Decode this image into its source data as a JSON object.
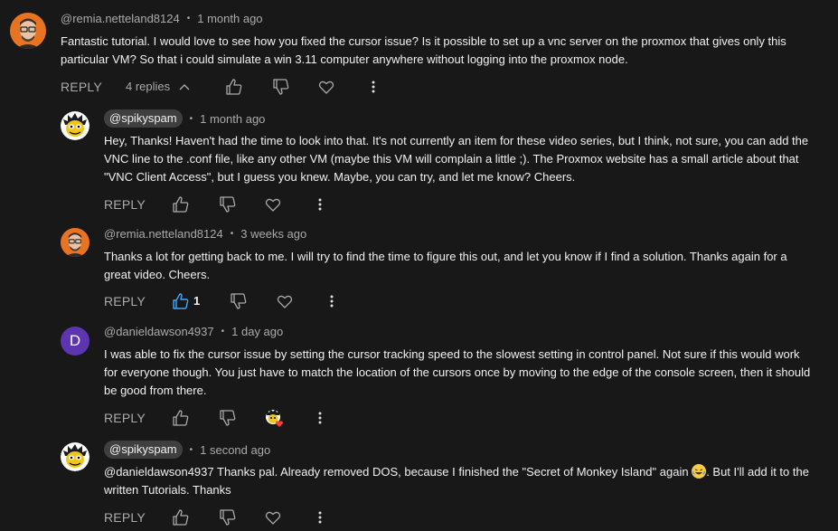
{
  "comments": [
    {
      "author": "@remia.netteland8124",
      "time": "1 month ago",
      "text_lines": [
        "Fantastic tutorial. I would love to see how you fixed the cursor issue? Is it possible to set up a vnc server on the proxmox that gives only this",
        "particular VM? So that i could simulate a win 3.11 computer anywhere without logging into the proxmox node."
      ],
      "reply_label": "REPLY",
      "replies_label": "4 replies"
    }
  ],
  "replies": [
    {
      "author": "@spikyspam",
      "time": "1 month ago",
      "text_lines": [
        "Hey, Thanks! Haven't had the time to look into that. It's not currently an item for these video series, but I think, not sure, you can add the",
        "VNC line to the .conf file, like any other VM (maybe this VM will complain a little ;). The Proxmox website has a small article about that",
        "\"VNC Client Access\", but I guess you knew. Maybe, you can try, and let me know? Cheers."
      ],
      "reply_label": "REPLY"
    },
    {
      "author": "@remia.netteland8124",
      "time": "3 weeks ago",
      "text_lines": [
        "Thanks a lot for getting back to me. I will try to find the time to figure this out, and let you know if I find a solution. Thanks again for a",
        "great video. Cheers."
      ],
      "reply_label": "REPLY",
      "like_count": "1"
    },
    {
      "author": "@danieldawson4937",
      "avatar_letter": "D",
      "time": "1 day ago",
      "text_lines": [
        "I was able to fix the cursor issue by setting the cursor tracking speed to the slowest setting in control panel. Not sure if this would work",
        "for everyone though. You just have to match the location of the cursors once by moving to the edge of the console screen, then it should",
        "be good from there."
      ],
      "reply_label": "REPLY"
    },
    {
      "author": "@spikyspam",
      "time": "1 second ago",
      "mention": "@danieldawson4937",
      "text_line1_rest": " Thanks pal. Already removed DOS, because I finished the \"Secret of Monkey Island\" again ",
      "text_line1_tail": ". But I'll add it to the",
      "text_line2": "written Tutorials. Thanks",
      "reply_label": "REPLY"
    }
  ],
  "colors": {
    "background": "#181818",
    "text": "#f1f1f1",
    "secondary": "#aaaaaa",
    "chip": "#3f3f3f",
    "like_active": "#3ea6ff",
    "avatar_d": "#5e35b1"
  }
}
